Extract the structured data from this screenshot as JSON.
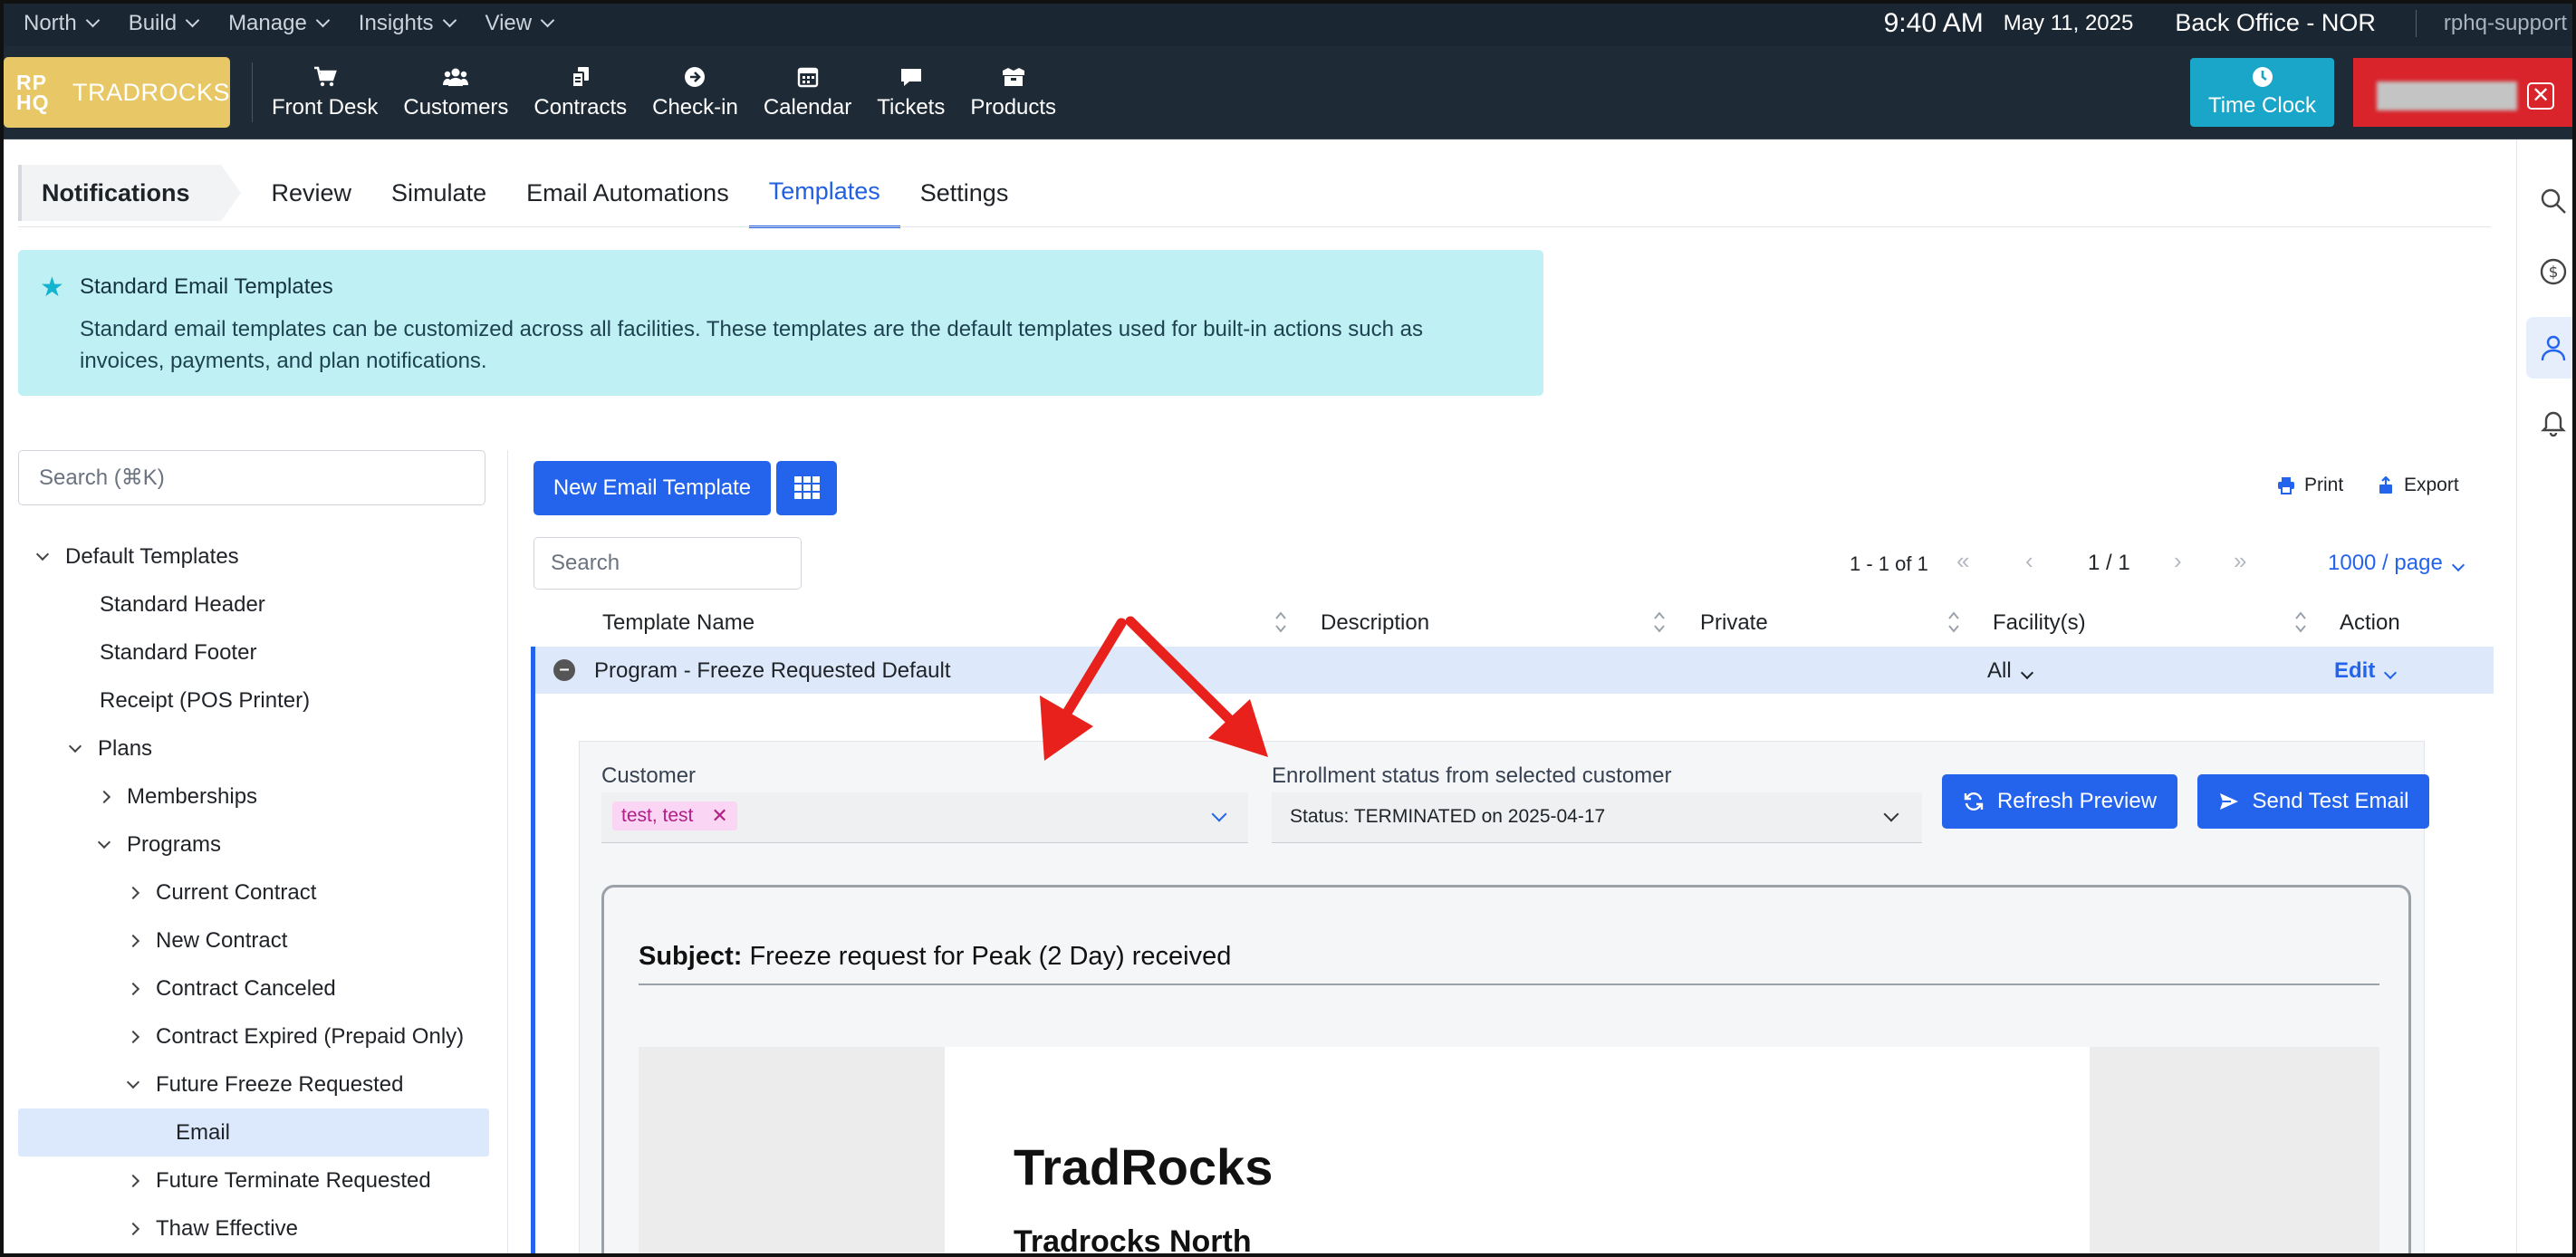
{
  "topbar": {
    "menus": [
      "North",
      "Build",
      "Manage",
      "Insights",
      "View"
    ],
    "time": "9:40 AM",
    "date": "May 11, 2025",
    "location": "Back Office - NOR",
    "user": "rphq-support"
  },
  "navbar": {
    "logo_mark": "RP HQ",
    "logo_text": "TRADROCKS",
    "items": [
      {
        "label": "Front Desk",
        "icon": "cart-icon"
      },
      {
        "label": "Customers",
        "icon": "users-icon"
      },
      {
        "label": "Contracts",
        "icon": "documents-icon"
      },
      {
        "label": "Check-in",
        "icon": "arrow-circle-icon"
      },
      {
        "label": "Calendar",
        "icon": "calendar-icon"
      },
      {
        "label": "Tickets",
        "icon": "chat-icon"
      },
      {
        "label": "Products",
        "icon": "box-icon"
      }
    ],
    "time_clock": "Time Clock"
  },
  "tabs": {
    "section": "Notifications",
    "items": [
      "Review",
      "Simulate",
      "Email Automations",
      "Templates",
      "Settings"
    ],
    "active": "Templates"
  },
  "banner": {
    "title": "Standard Email Templates",
    "text": "Standard email templates can be customized across all facilities. These templates are the default templates used for built-in actions such as invoices, payments, and plan notifications."
  },
  "sidebar": {
    "search_placeholder": "Search (⌘K)",
    "tree": [
      {
        "label": "Default Templates",
        "level": 0,
        "caret": "down"
      },
      {
        "label": "Standard Header",
        "level": 1,
        "caret": "none"
      },
      {
        "label": "Standard Footer",
        "level": 1,
        "caret": "none"
      },
      {
        "label": "Receipt (POS Printer)",
        "level": 1,
        "caret": "none"
      },
      {
        "label": "Plans",
        "level": 1,
        "caret": "down"
      },
      {
        "label": "Memberships",
        "level": 2,
        "caret": "right"
      },
      {
        "label": "Programs",
        "level": 2,
        "caret": "down"
      },
      {
        "label": "Current Contract",
        "level": 3,
        "caret": "right"
      },
      {
        "label": "New Contract",
        "level": 3,
        "caret": "right"
      },
      {
        "label": "Contract Canceled",
        "level": 3,
        "caret": "right"
      },
      {
        "label": "Contract Expired (Prepaid Only)",
        "level": 3,
        "caret": "right"
      },
      {
        "label": "Future Freeze Requested",
        "level": 3,
        "caret": "down"
      },
      {
        "label": "Email",
        "level": 4,
        "caret": "none",
        "selected": true
      },
      {
        "label": "Future Terminate Requested",
        "level": 3,
        "caret": "right"
      },
      {
        "label": "Thaw Effective",
        "level": 3,
        "caret": "right"
      }
    ]
  },
  "toolbar": {
    "new_template": "New Email Template",
    "print": "Print",
    "export": "Export",
    "search_placeholder": "Search",
    "range": "1 - 1 of 1",
    "page": "1 / 1",
    "per_page": "1000 / page"
  },
  "table": {
    "columns": [
      "Template Name",
      "Description",
      "Private",
      "Facility(s)",
      "Action"
    ],
    "row": {
      "name": "Program - Freeze Requested Default",
      "facility": "All",
      "action": "Edit"
    }
  },
  "preview": {
    "customer_label": "Customer",
    "customer_tag": "test, test",
    "status_label": "Enrollment status from selected customer",
    "status_value": "Status: TERMINATED on 2025-04-17",
    "refresh": "Refresh Preview",
    "send": "Send Test Email",
    "subject_label": "Subject:",
    "subject": "Freeze request for Peak (2 Day) received",
    "email_heading": "TradRocks",
    "email_subheading": "Tradrocks North"
  },
  "colors": {
    "accent": "#2463eb",
    "annotation_arrow": "#e8211c",
    "banner_bg": "#bff1f4",
    "logo_bg": "#e8c866",
    "time_clock_bg": "#1aa6c9"
  }
}
